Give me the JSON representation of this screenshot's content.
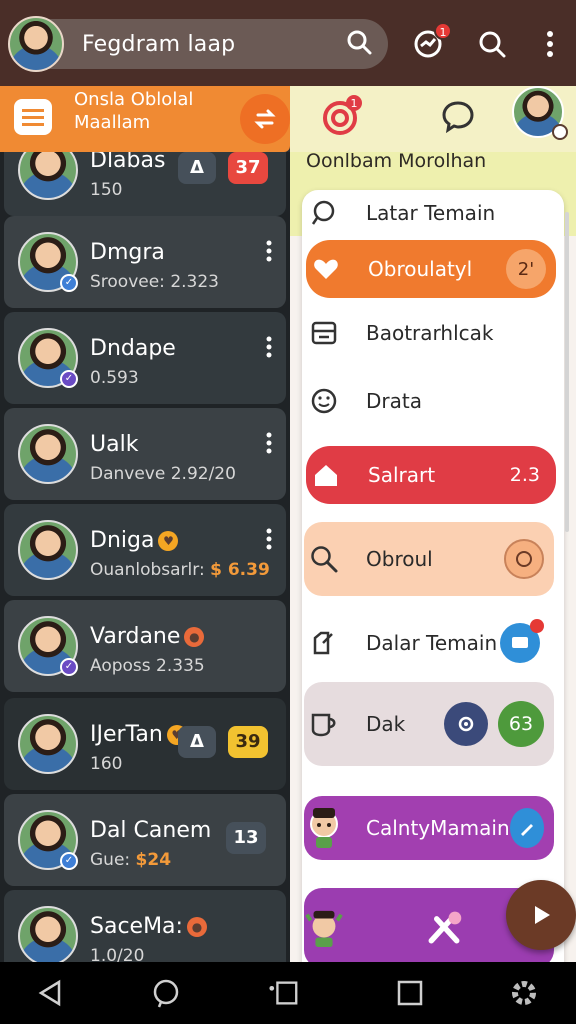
{
  "topbar": {
    "title": "Fegdram laap",
    "notif_count": "1"
  },
  "subbar": {
    "label_line1": "Onsla Oblolal",
    "label_line2": "Maallam",
    "target_count": "1"
  },
  "contacts": [
    {
      "name": "Dlabas",
      "sub": "150",
      "pill": "37",
      "pill_alt": "Δ"
    },
    {
      "name": "Dmgra",
      "sub": "Sroovee: 2.323"
    },
    {
      "name": "Dndape",
      "sub": "0.593"
    },
    {
      "name": "Ualk",
      "sub": "Danveve 2.92/20"
    },
    {
      "name": "Dniga",
      "sub_prefix": "Ouanlobsarlr:",
      "sub_money": "$ 6.39"
    },
    {
      "name": "Vardane",
      "sub": "Aoposs 2.335"
    },
    {
      "name": "IJerTan",
      "sub": "160",
      "pill": "39",
      "pill_alt": "Δ"
    },
    {
      "name": "Dal Canem",
      "sub_prefix": "Gue:",
      "sub_money": "$24",
      "pill": "13"
    },
    {
      "name": "SaceMa:",
      "sub": "1.0/20"
    }
  ],
  "panel": {
    "header": "Oonlbam Morolhan",
    "items": [
      {
        "label": "Latar Temain"
      },
      {
        "label": "Obroulatyl",
        "count": "2'"
      },
      {
        "label": "Baotrarhlcak"
      },
      {
        "label": "Drata"
      },
      {
        "label": "Salrart",
        "count": "2.3"
      },
      {
        "label": "Obroul"
      },
      {
        "label": "Dalar Temain"
      },
      {
        "label": "Dak",
        "count": "63"
      },
      {
        "label": "CalntyMamain"
      },
      {
        "label": ""
      }
    ]
  },
  "colors": {
    "accent": "#f08a33",
    "topbar": "#4a2e28",
    "danger": "#e03c45",
    "purple": "#a23fb0"
  }
}
